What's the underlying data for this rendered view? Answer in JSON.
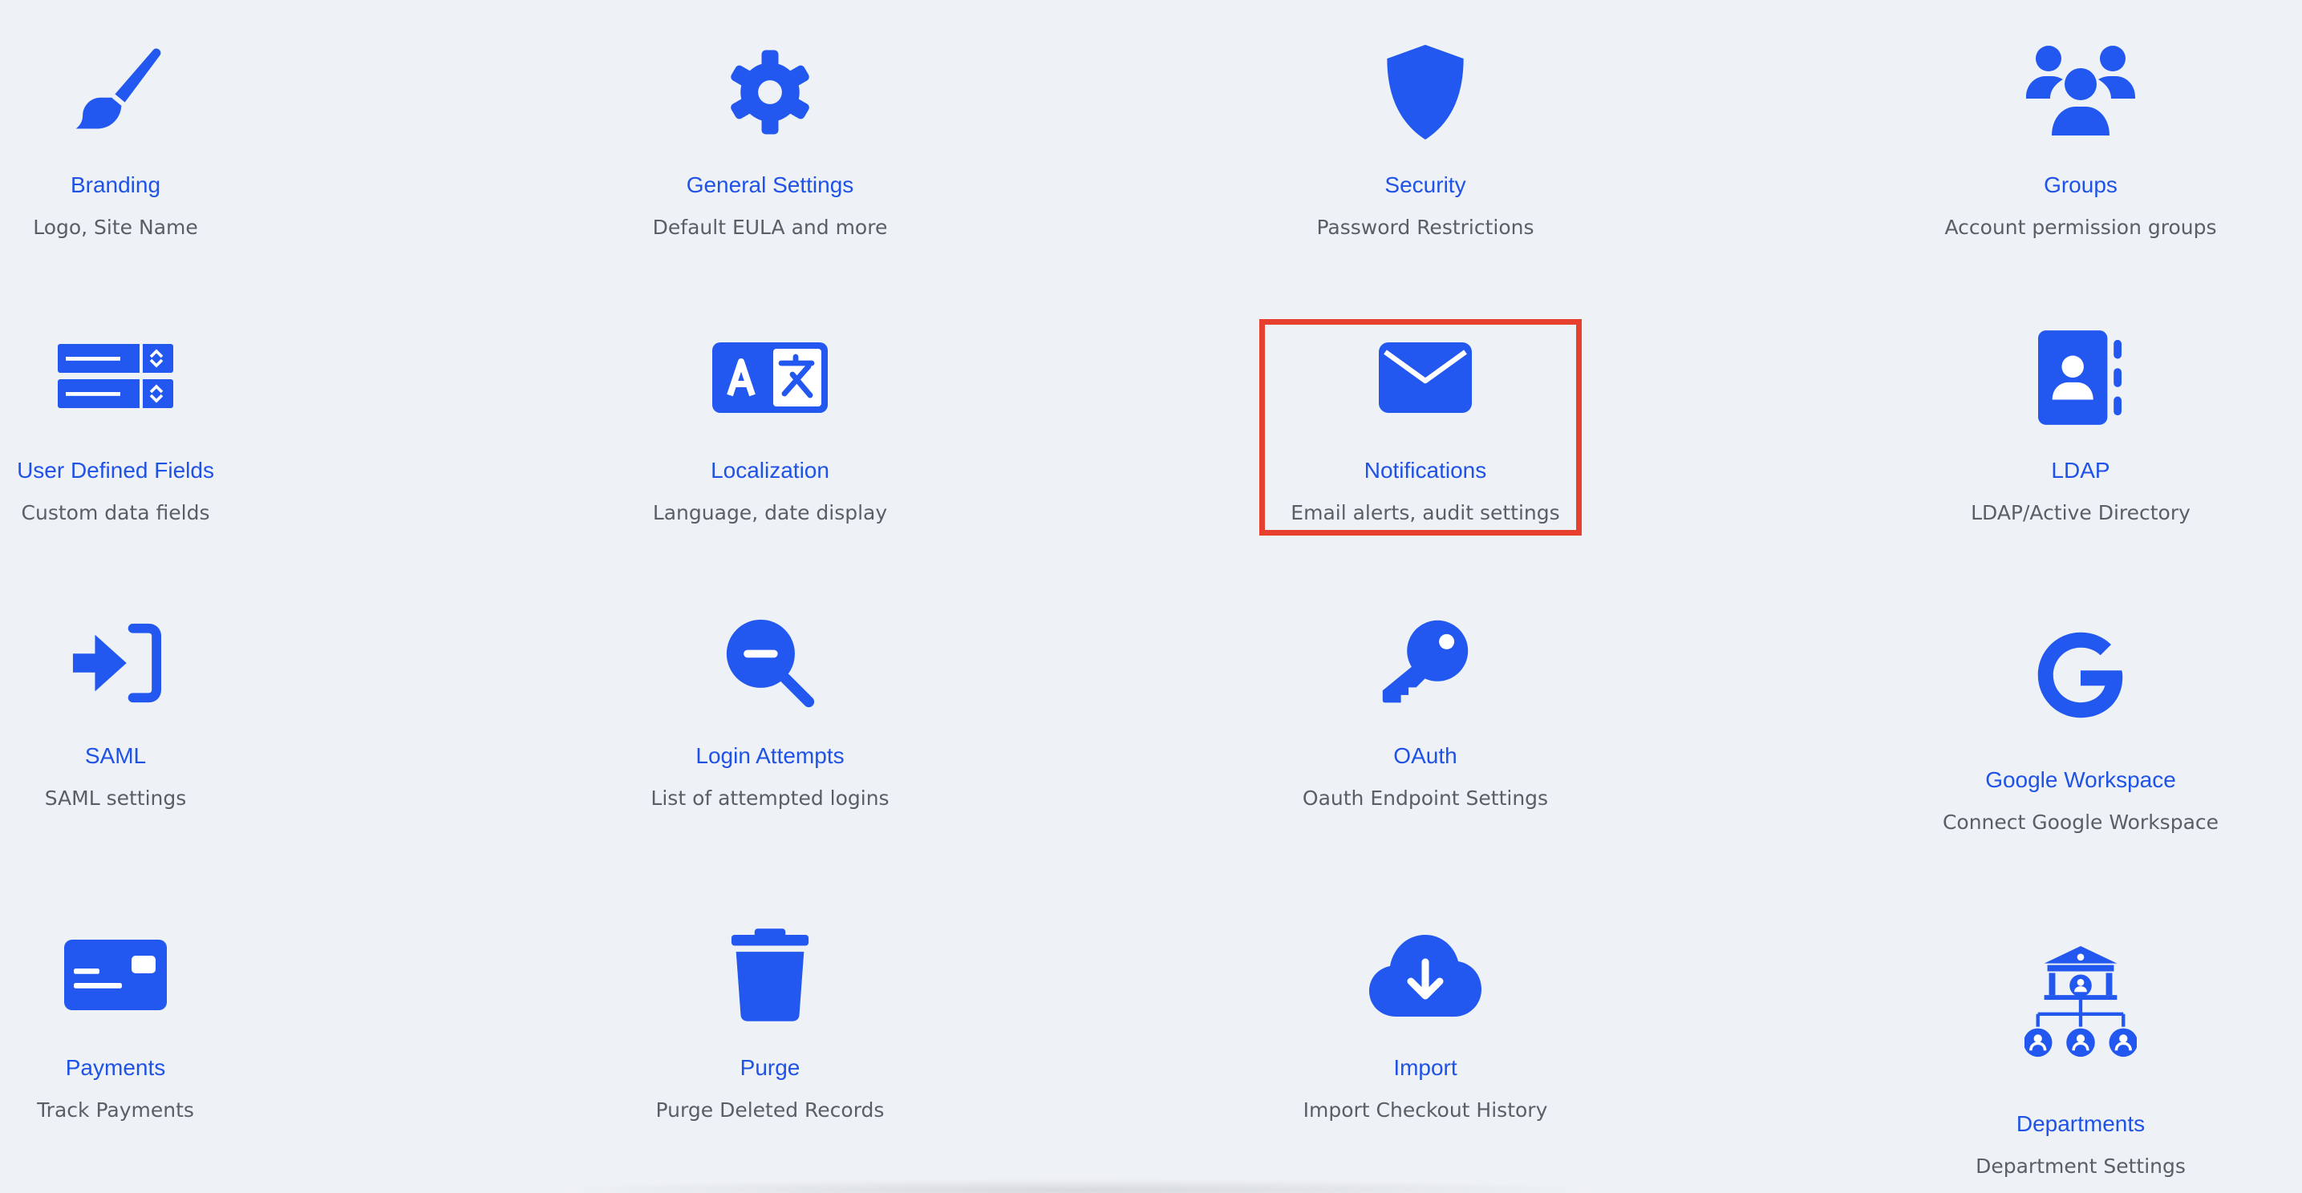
{
  "accent_color": "#2258f0",
  "title_color": "#1f52e6",
  "highlight_color": "#e8402e",
  "tiles": [
    {
      "icon": "paintbrush-icon",
      "title": "Branding",
      "desc": "Logo, Site Name"
    },
    {
      "icon": "gear-icon",
      "title": "General Settings",
      "desc": "Default EULA and more"
    },
    {
      "icon": "shield-icon",
      "title": "Security",
      "desc": "Password Restrictions"
    },
    {
      "icon": "users-icon",
      "title": "Groups",
      "desc": "Account permission groups"
    },
    {
      "icon": "list-fields-icon",
      "title": "User Defined Fields",
      "desc": "Custom data fields"
    },
    {
      "icon": "language-icon",
      "title": "Localization",
      "desc": "Language, date display"
    },
    {
      "icon": "envelope-icon",
      "title": "Notifications",
      "desc": "Email alerts, audit settings"
    },
    {
      "icon": "address-book-icon",
      "title": "LDAP",
      "desc": "LDAP/Active Directory"
    },
    {
      "icon": "sign-in-icon",
      "title": "SAML",
      "desc": "SAML settings"
    },
    {
      "icon": "search-minus-icon",
      "title": "Login Attempts",
      "desc": "List of attempted logins"
    },
    {
      "icon": "key-icon",
      "title": "OAuth",
      "desc": "Oauth Endpoint Settings"
    },
    {
      "icon": "google-icon",
      "title": "Google Workspace",
      "desc": "Connect Google Workspace"
    },
    {
      "icon": "card-icon",
      "title": "Payments",
      "desc": "Track Payments"
    },
    {
      "icon": "trash-icon",
      "title": "Purge",
      "desc": "Purge Deleted Records"
    },
    {
      "icon": "cloud-download-icon",
      "title": "Import",
      "desc": "Import Checkout History"
    },
    {
      "icon": "departments-icon",
      "title": "Departments",
      "desc": "Department Settings"
    }
  ]
}
